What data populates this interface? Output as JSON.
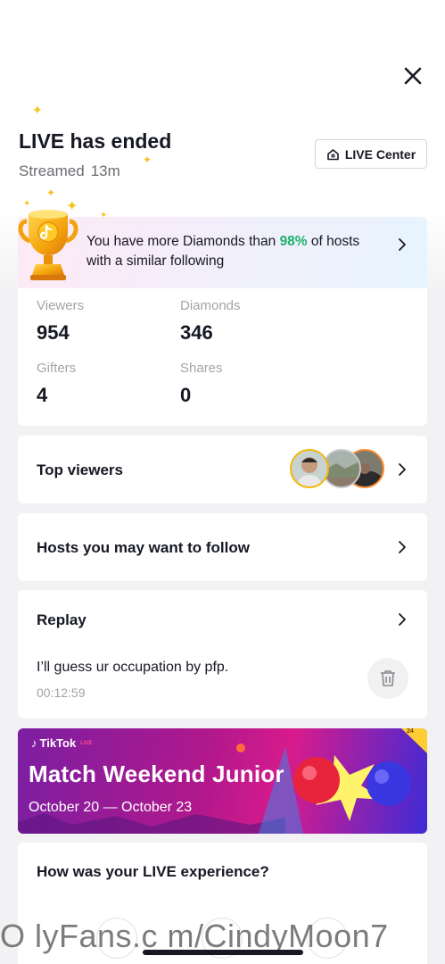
{
  "header": {
    "title": "LIVE has ended",
    "streamed_label": "Streamed",
    "duration": "13m",
    "live_center_label": "LIVE Center"
  },
  "rank": {
    "text_before": "You have more Diamonds than ",
    "percent": "98%",
    "text_after": " of hosts with a similar following",
    "accent_color": "#20b26c"
  },
  "stats": [
    {
      "label": "Viewers",
      "value": "954"
    },
    {
      "label": "Diamonds",
      "value": "346"
    },
    {
      "label": "Gifters",
      "value": "4"
    },
    {
      "label": "Shares",
      "value": "0"
    }
  ],
  "top_viewers": {
    "label": "Top viewers"
  },
  "hosts_follow": {
    "label": "Hosts you may want to follow"
  },
  "replay": {
    "label": "Replay",
    "caption": "I’ll guess ur occupation by pfp.",
    "time": "00:12:59"
  },
  "promo": {
    "brand": "TikTok",
    "brand_tag": "LIVE",
    "title": "Match Weekend Junior",
    "dates": "October 20 — October 23",
    "corner_badge": "24"
  },
  "feedback": {
    "question": "How was your LIVE experience?"
  },
  "watermark": "O lyFans.c m/CindyMoon7"
}
